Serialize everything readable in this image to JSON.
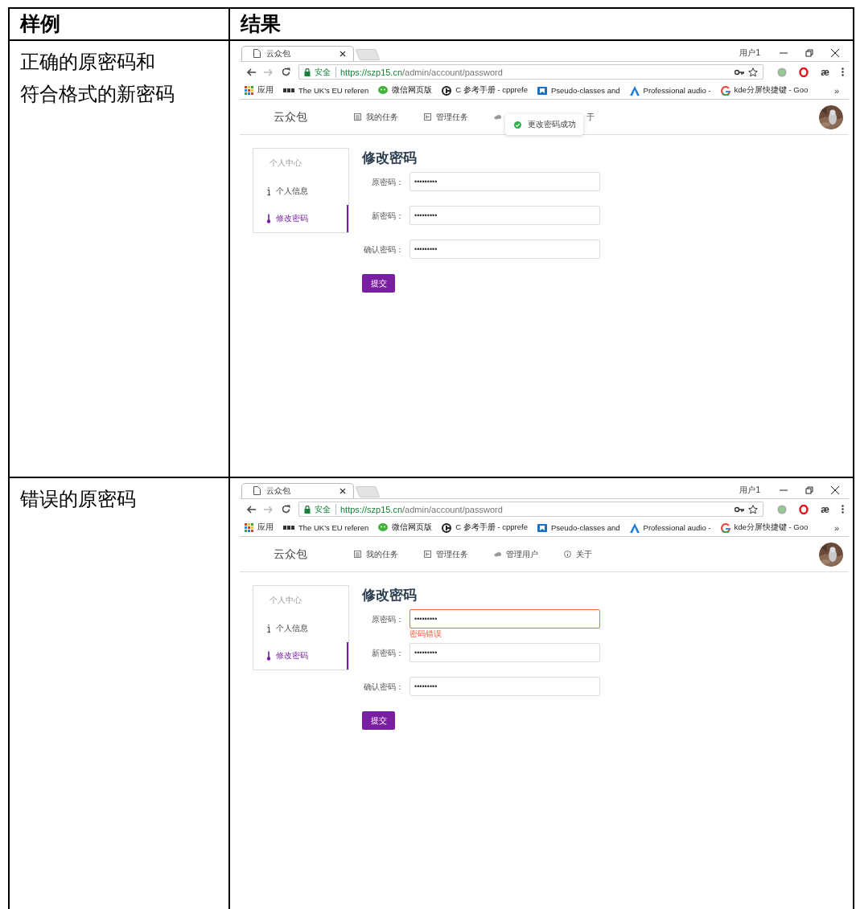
{
  "table": {
    "columns": [
      {
        "label": "样例"
      },
      {
        "label": "结果"
      }
    ],
    "rows": [
      {
        "case_lines": [
          "正确的原密码和",
          "符合格式的新密码"
        ],
        "browser": {
          "tab_title": "云众包",
          "window_user": "用户1",
          "security_label": "安全",
          "url_host": "https://szp15.cn",
          "url_path": "/admin/account/password",
          "extension_text": "æ",
          "bookmarks": [
            {
              "kind": "apps",
              "label": "应用"
            },
            {
              "kind": "bbc",
              "label": "The UK's EU referen"
            },
            {
              "kind": "wechat",
              "label": "微信网页版"
            },
            {
              "kind": "cpp",
              "label": "C 参考手册 - cpprefe"
            },
            {
              "kind": "bookmark",
              "label": "Pseudo-classes and"
            },
            {
              "kind": "peak",
              "label": "Professional audio -"
            },
            {
              "kind": "google",
              "label": "kde分屏快捷键 - Goo"
            }
          ],
          "bookmarks_more": "»",
          "site": {
            "brand": "云众包",
            "nav": [
              {
                "kind": "list",
                "label": "我的任务"
              },
              {
                "kind": "grid",
                "label": "管理任务"
              },
              {
                "kind": "users"
              },
              {
                "kind": "info",
                "label": "于",
                "clipped": true
              }
            ],
            "toast": "更改密码成功",
            "sidebar": {
              "title": "个人中心",
              "items": [
                {
                  "kind": "info",
                  "label": "个人信息",
                  "selected": false
                },
                {
                  "kind": "thermo",
                  "label": "修改密码",
                  "selected": true
                }
              ]
            },
            "form": {
              "title": "修改密码",
              "fields": [
                {
                  "label": "原密码：",
                  "value": "•••••••••"
                },
                {
                  "label": "新密码：",
                  "value": "•••••••••"
                },
                {
                  "label": "确认密码：",
                  "value": "•••••••••"
                }
              ],
              "submit": "提交"
            }
          }
        }
      },
      {
        "case_lines": [
          "错误的原密码"
        ],
        "browser": {
          "tab_title": "云众包",
          "window_user": "用户1",
          "security_label": "安全",
          "url_host": "https://szp15.cn",
          "url_path": "/admin/account/password",
          "extension_text": "æ",
          "bookmarks": [
            {
              "kind": "apps",
              "label": "应用"
            },
            {
              "kind": "bbc",
              "label": "The UK's EU referen"
            },
            {
              "kind": "wechat",
              "label": "微信网页版"
            },
            {
              "kind": "cpp",
              "label": "C 参考手册 - cpprefe"
            },
            {
              "kind": "bookmark",
              "label": "Pseudo-classes and"
            },
            {
              "kind": "peak",
              "label": "Professional audio -"
            },
            {
              "kind": "google",
              "label": "kde分屏快捷键 - Goo"
            }
          ],
          "bookmarks_more": "»",
          "site": {
            "brand": "云众包",
            "nav": [
              {
                "kind": "list",
                "label": "我的任务"
              },
              {
                "kind": "grid",
                "label": "管理任务"
              },
              {
                "kind": "users",
                "label": "管理用户"
              },
              {
                "kind": "info",
                "label": "关于"
              }
            ],
            "sidebar": {
              "title": "个人中心",
              "items": [
                {
                  "kind": "info",
                  "label": "个人信息",
                  "selected": false
                },
                {
                  "kind": "thermo",
                  "label": "修改密码",
                  "selected": true
                }
              ]
            },
            "form": {
              "title": "修改密码",
              "fields": [
                {
                  "label": "原密码：",
                  "value": "•••••••••",
                  "error": "密码错误"
                },
                {
                  "label": "新密码：",
                  "value": "•••••••••"
                },
                {
                  "label": "确认密码：",
                  "value": "•••••••••"
                }
              ],
              "submit": "提交"
            }
          }
        }
      }
    ]
  }
}
